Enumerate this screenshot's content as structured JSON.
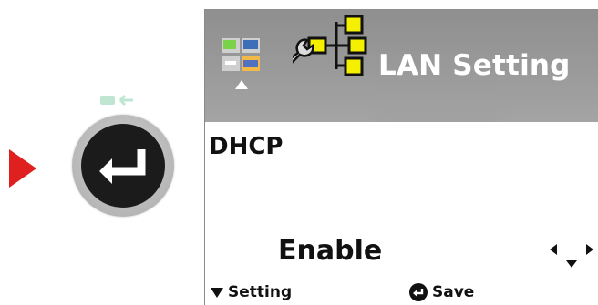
{
  "screen": {
    "title": "LAN Setting",
    "field_label": "DHCP",
    "field_value": "Enable"
  },
  "footer": {
    "left_label": "Setting",
    "right_label": "Save"
  },
  "icons": {
    "pointer": "pointer-arrow-icon",
    "enter_key": "enter-key-icon",
    "app": "app-menu-icon",
    "lan": "lan-network-wrench-icon",
    "nav": "navigation-arrows-icon"
  },
  "colors": {
    "header_bg": "#9a9a9a",
    "pointer": "#e0201e",
    "lan_node": "#f5f000"
  }
}
